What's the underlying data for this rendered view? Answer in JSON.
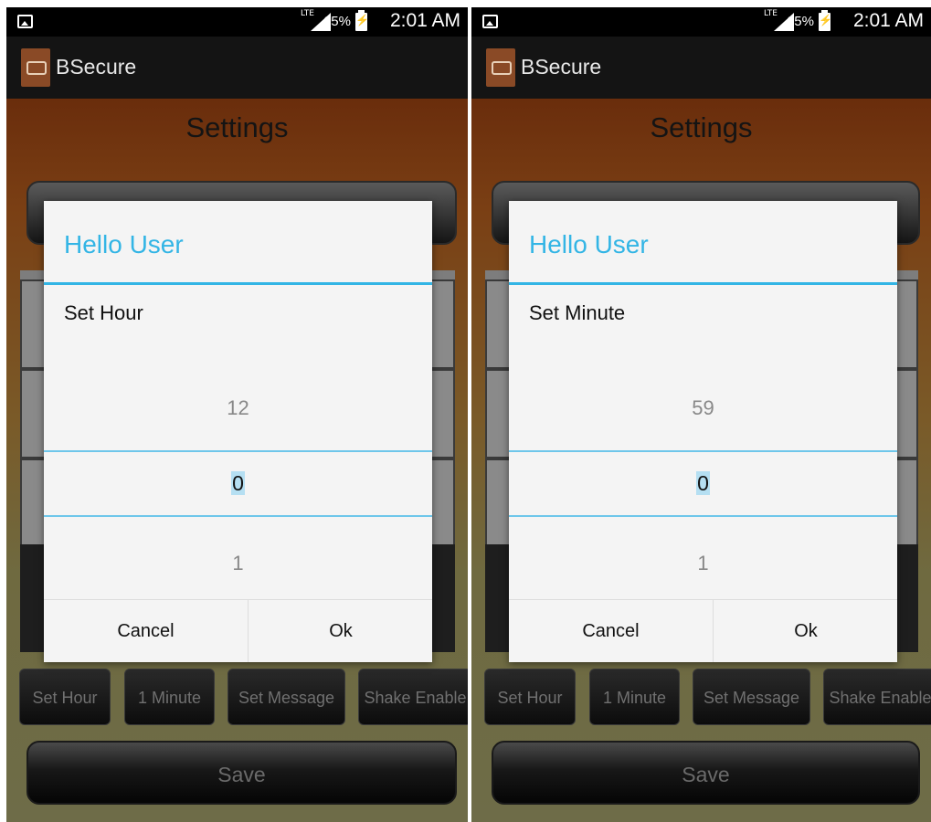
{
  "status_bar": {
    "network": "LTE",
    "battery": "65%",
    "time": "2:01 AM"
  },
  "app": {
    "name": "BSecure",
    "page_title": "Settings"
  },
  "bottom_buttons": [
    "Set Hour",
    "1 Minute",
    "Set Message",
    "Shake Enable"
  ],
  "save_label": "Save",
  "dialogs": [
    {
      "title": "Hello User",
      "message": "Set Hour",
      "picker": {
        "previous": "12",
        "current": "0",
        "next": "1"
      },
      "cancel_label": "Cancel",
      "ok_label": "Ok"
    },
    {
      "title": "Hello User",
      "message": "Set Minute",
      "picker": {
        "previous": "59",
        "current": "0",
        "next": "1"
      },
      "cancel_label": "Cancel",
      "ok_label": "Ok"
    }
  ],
  "colors": {
    "accent": "#33b5e5",
    "action_bar": "#141414",
    "header_brown": "#6a2d0c"
  }
}
